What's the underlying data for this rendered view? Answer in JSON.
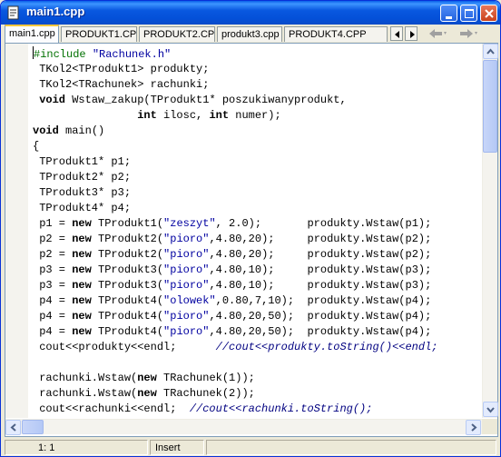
{
  "window": {
    "title": "main1.cpp"
  },
  "tabs": [
    {
      "label": "main1.cpp",
      "active": true
    },
    {
      "label": "PRODUKT1.CPP",
      "active": false
    },
    {
      "label": "PRODUKT2.CPP",
      "active": false
    },
    {
      "label": "produkt3.cpp",
      "active": false
    },
    {
      "label": "PRODUKT4.CPP",
      "active": false
    }
  ],
  "tab_scroll": {
    "left_icon": "triangle-left-icon",
    "right_icon": "triangle-right-icon"
  },
  "nav": {
    "back_icon": "arrow-left-icon",
    "forward_icon": "arrow-right-icon"
  },
  "code": {
    "lines": [
      [
        [
          "pp",
          "#include "
        ],
        [
          "str",
          "\"Rachunek.h\""
        ]
      ],
      [
        [
          "n",
          " TKol2<TProdukt1> produkty;"
        ]
      ],
      [
        [
          "n",
          " TKol2<TRachunek> rachunki;"
        ]
      ],
      [
        [
          "n",
          " "
        ],
        [
          "kw",
          "void"
        ],
        [
          "n",
          " Wstaw_zakup(TProdukt1* poszukiwanyprodukt,"
        ]
      ],
      [
        [
          "n",
          "                "
        ],
        [
          "kw",
          "int"
        ],
        [
          "n",
          " ilosc, "
        ],
        [
          "kw",
          "int"
        ],
        [
          "n",
          " numer);"
        ]
      ],
      [
        [
          "kw",
          "void"
        ],
        [
          "n",
          " main()"
        ]
      ],
      [
        [
          "n",
          "{"
        ]
      ],
      [
        [
          "n",
          " TProdukt1* p1;"
        ]
      ],
      [
        [
          "n",
          " TProdukt2* p2;"
        ]
      ],
      [
        [
          "n",
          " TProdukt3* p3;"
        ]
      ],
      [
        [
          "n",
          " TProdukt4* p4;"
        ]
      ],
      [
        [
          "n",
          " p1 = "
        ],
        [
          "kw",
          "new"
        ],
        [
          "n",
          " TProdukt1("
        ],
        [
          "str",
          "\"zeszyt\""
        ],
        [
          "n",
          ", 2.0);       produkty.Wstaw(p1);"
        ]
      ],
      [
        [
          "n",
          " p2 = "
        ],
        [
          "kw",
          "new"
        ],
        [
          "n",
          " TProdukt2("
        ],
        [
          "str",
          "\"pioro\""
        ],
        [
          "n",
          ",4.80,20);     produkty.Wstaw(p2);"
        ]
      ],
      [
        [
          "n",
          " p2 = "
        ],
        [
          "kw",
          "new"
        ],
        [
          "n",
          " TProdukt2("
        ],
        [
          "str",
          "\"pioro\""
        ],
        [
          "n",
          ",4.80,20);     produkty.Wstaw(p2);"
        ]
      ],
      [
        [
          "n",
          " p3 = "
        ],
        [
          "kw",
          "new"
        ],
        [
          "n",
          " TProdukt3("
        ],
        [
          "str",
          "\"pioro\""
        ],
        [
          "n",
          ",4.80,10);     produkty.Wstaw(p3);"
        ]
      ],
      [
        [
          "n",
          " p3 = "
        ],
        [
          "kw",
          "new"
        ],
        [
          "n",
          " TProdukt3("
        ],
        [
          "str",
          "\"pioro\""
        ],
        [
          "n",
          ",4.80,10);     produkty.Wstaw(p3);"
        ]
      ],
      [
        [
          "n",
          " p4 = "
        ],
        [
          "kw",
          "new"
        ],
        [
          "n",
          " TProdukt4("
        ],
        [
          "str",
          "\"olowek\""
        ],
        [
          "n",
          ",0.80,7,10);  produkty.Wstaw(p4);"
        ]
      ],
      [
        [
          "n",
          " p4 = "
        ],
        [
          "kw",
          "new"
        ],
        [
          "n",
          " TProdukt4("
        ],
        [
          "str",
          "\"pioro\""
        ],
        [
          "n",
          ",4.80,20,50);  produkty.Wstaw(p4);"
        ]
      ],
      [
        [
          "n",
          " p4 = "
        ],
        [
          "kw",
          "new"
        ],
        [
          "n",
          " TProdukt4("
        ],
        [
          "str",
          "\"pioro\""
        ],
        [
          "n",
          ",4.80,20,50);  produkty.Wstaw(p4);"
        ]
      ],
      [
        [
          "n",
          " cout<<produkty<<endl;      "
        ],
        [
          "cm",
          "//cout<<produkty.toString()<<endl;"
        ]
      ],
      [
        [
          "n",
          ""
        ]
      ],
      [
        [
          "n",
          " rachunki.Wstaw("
        ],
        [
          "kw",
          "new"
        ],
        [
          "n",
          " TRachunek(1));"
        ]
      ],
      [
        [
          "n",
          " rachunki.Wstaw("
        ],
        [
          "kw",
          "new"
        ],
        [
          "n",
          " TRachunek(2));"
        ]
      ],
      [
        [
          "n",
          " cout<<rachunki<<endl;  "
        ],
        [
          "cm",
          "//cout<<rachunki.toString();"
        ]
      ]
    ]
  },
  "status": {
    "position": "1:  1",
    "mode": "Insert",
    "extra": ""
  }
}
